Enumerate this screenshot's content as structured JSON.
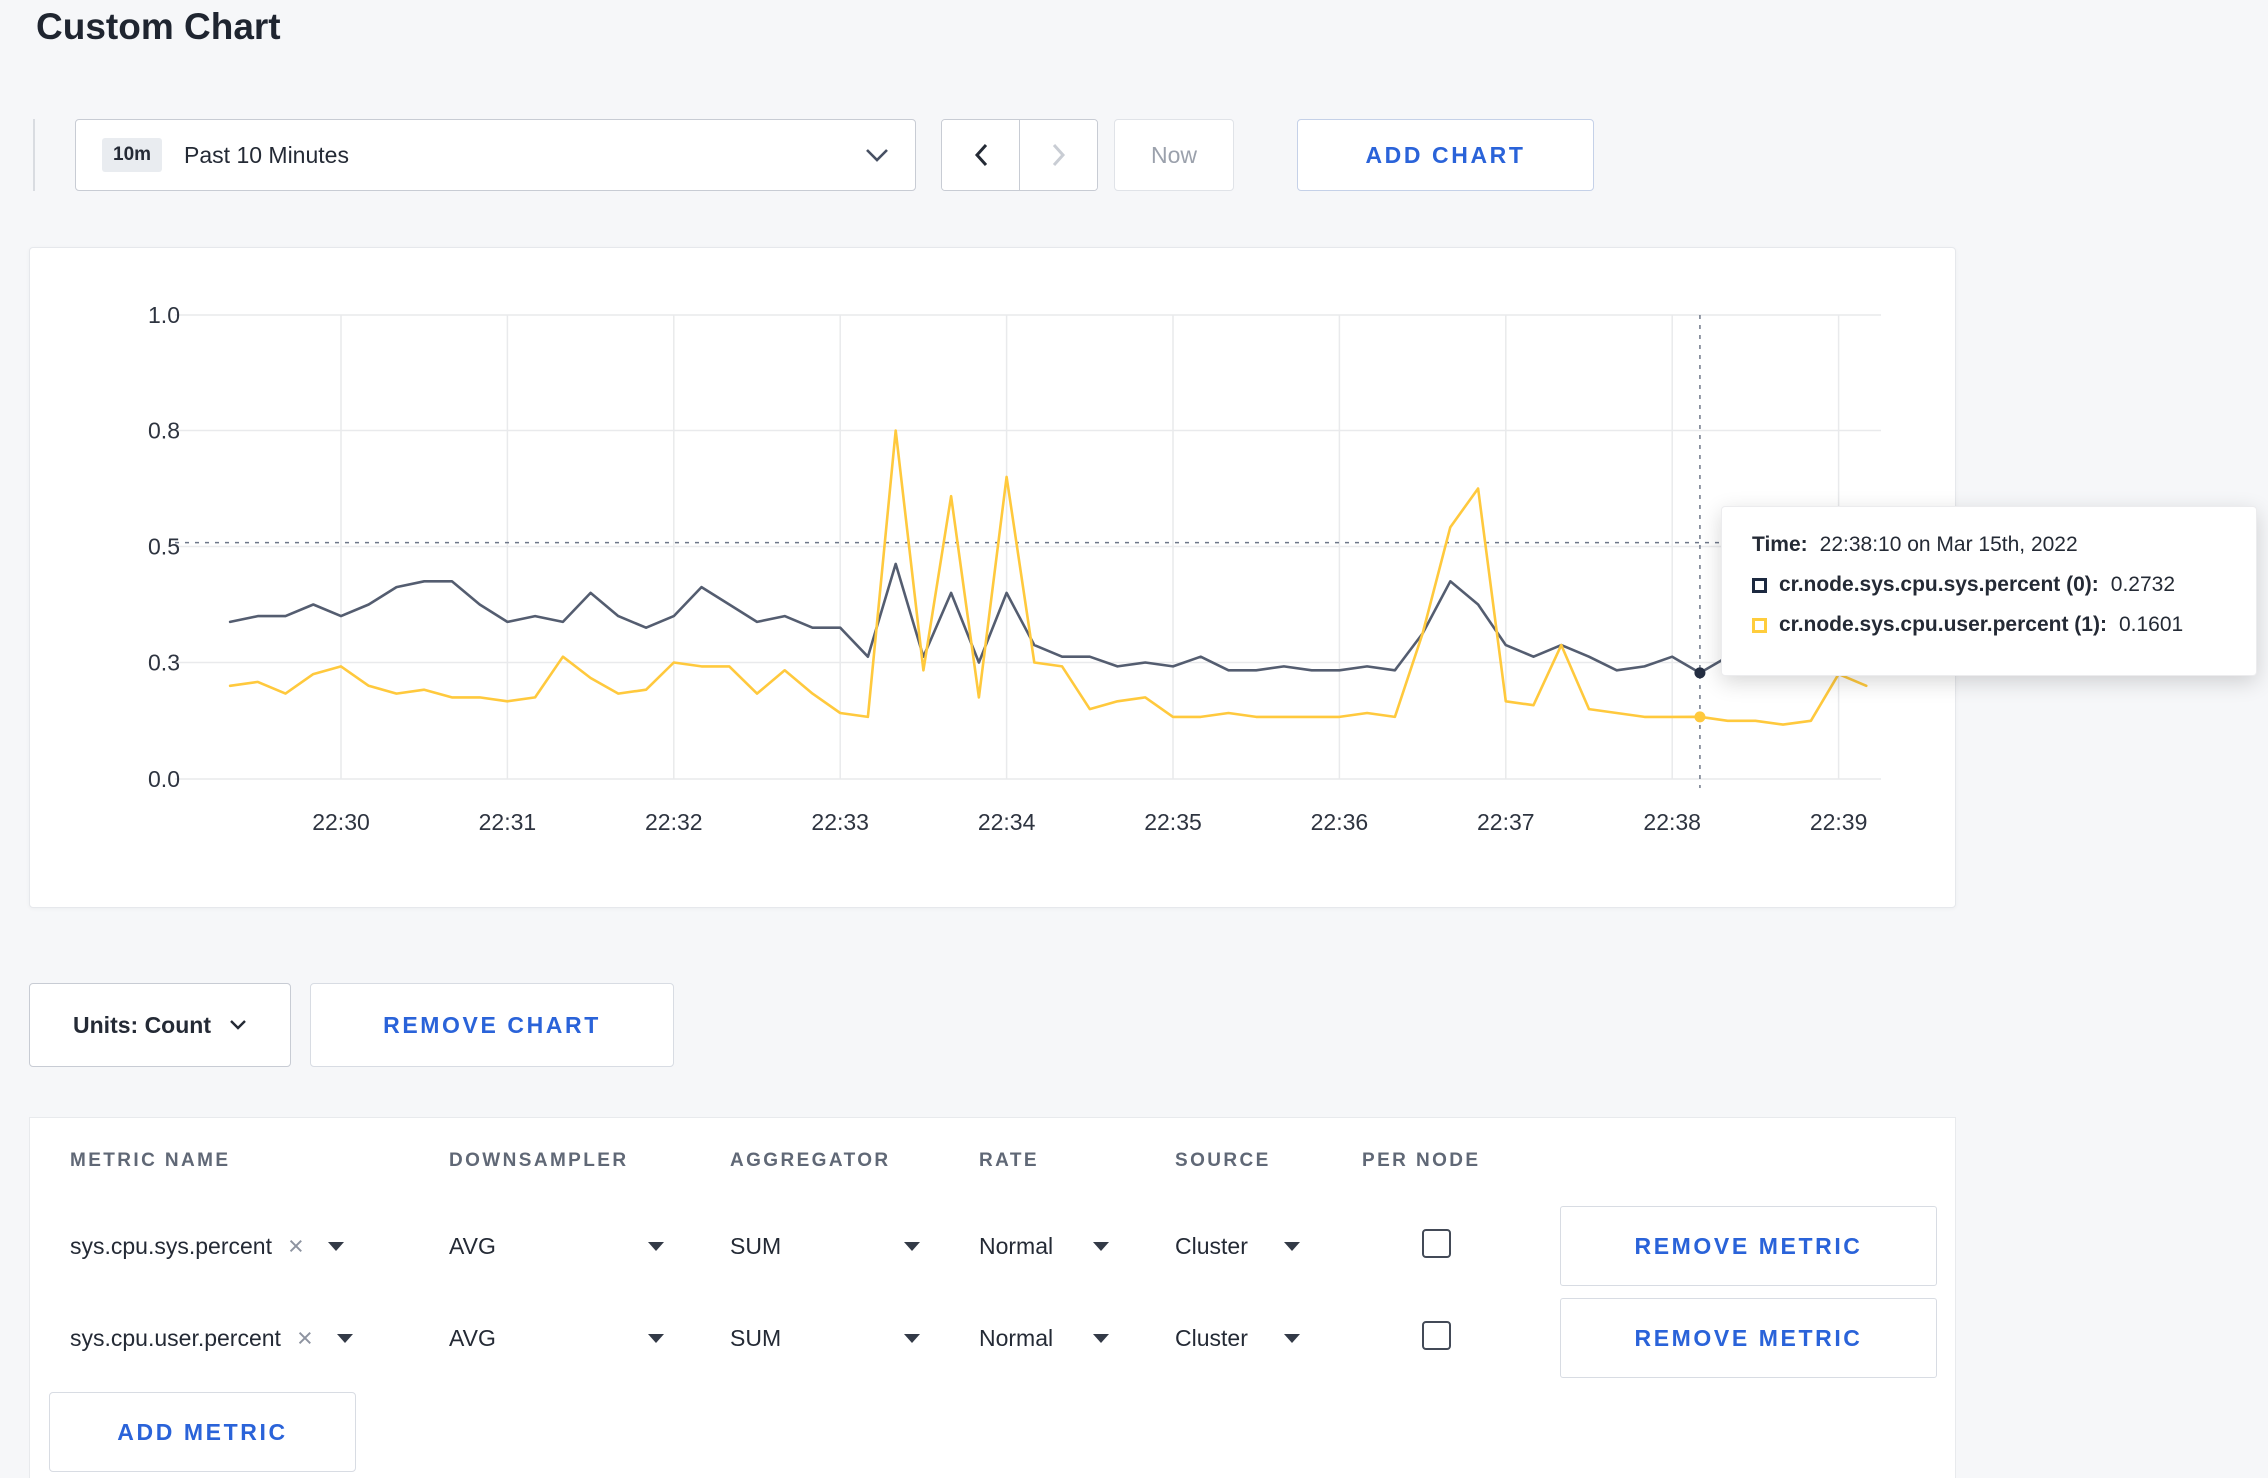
{
  "page": {
    "title": "Custom Chart"
  },
  "toolbar": {
    "range_badge": "10m",
    "range_label": "Past 10 Minutes",
    "now_label": "Now",
    "add_chart_label": "ADD CHART"
  },
  "chart_controls": {
    "units_label": "Units: Count",
    "remove_chart_label": "REMOVE CHART"
  },
  "tooltip": {
    "time_label": "Time:",
    "time_value": "22:38:10 on Mar 15th, 2022",
    "rows": [
      {
        "label": "cr.node.sys.cpu.sys.percent (0):",
        "value": "0.2732",
        "color": "#1c2940"
      },
      {
        "label": "cr.node.sys.cpu.user.percent (1):",
        "value": "0.1601",
        "color": "#ffcd3c"
      }
    ]
  },
  "chart_data": {
    "type": "line",
    "title": "",
    "xlabel": "",
    "ylabel": "",
    "grid": true,
    "legend_position": "none",
    "y_ticks": [
      0.0,
      0.3,
      0.5,
      0.8,
      1.0
    ],
    "y_tick_labels": [
      "0.0",
      "0.3",
      "0.5",
      "0.8",
      "1.0"
    ],
    "x_ticks": [
      "22:30",
      "22:31",
      "22:32",
      "22:33",
      "22:34",
      "22:35",
      "22:36",
      "22:37",
      "22:38",
      "22:39"
    ],
    "x_seconds_from_22_30": [
      -40,
      -30,
      -20,
      -10,
      0,
      10,
      20,
      30,
      40,
      50,
      60,
      70,
      80,
      90,
      100,
      110,
      120,
      130,
      140,
      150,
      160,
      170,
      180,
      190,
      200,
      210,
      220,
      230,
      240,
      250,
      260,
      270,
      280,
      290,
      300,
      310,
      320,
      330,
      340,
      350,
      360,
      370,
      380,
      390,
      400,
      410,
      420,
      430,
      440,
      450,
      460,
      470,
      480,
      490,
      500,
      510,
      520,
      530,
      540,
      550
    ],
    "series": [
      {
        "name": "cr.node.sys.cpu.sys.percent",
        "color": "#545d70",
        "dot_color": "#242e42",
        "values": [
          0.37,
          0.38,
          0.38,
          0.4,
          0.38,
          0.4,
          0.43,
          0.44,
          0.44,
          0.4,
          0.37,
          0.38,
          0.37,
          0.42,
          0.38,
          0.36,
          0.38,
          0.43,
          0.4,
          0.37,
          0.38,
          0.36,
          0.36,
          0.31,
          0.47,
          0.31,
          0.42,
          0.3,
          0.42,
          0.33,
          0.31,
          0.31,
          0.29,
          0.3,
          0.29,
          0.31,
          0.28,
          0.28,
          0.29,
          0.28,
          0.28,
          0.29,
          0.28,
          0.35,
          0.44,
          0.4,
          0.33,
          0.31,
          0.33,
          0.31,
          0.28,
          0.29,
          0.31,
          0.2732,
          0.31,
          0.3,
          null,
          null,
          null,
          null
        ]
      },
      {
        "name": "cr.node.sys.cpu.user.percent",
        "color": "#ffc93d",
        "dot_color": "#ffc93d",
        "values": [
          0.24,
          0.25,
          0.22,
          0.27,
          0.29,
          0.24,
          0.22,
          0.23,
          0.21,
          0.21,
          0.2,
          0.21,
          0.31,
          0.26,
          0.22,
          0.23,
          0.3,
          0.29,
          0.29,
          0.22,
          0.28,
          0.22,
          0.17,
          0.16,
          0.8,
          0.28,
          0.63,
          0.21,
          0.68,
          0.3,
          0.29,
          0.18,
          0.2,
          0.21,
          0.16,
          0.16,
          0.17,
          0.16,
          0.16,
          0.16,
          0.16,
          0.17,
          0.16,
          0.35,
          0.55,
          0.65,
          0.2,
          0.19,
          0.33,
          0.18,
          0.17,
          0.16,
          0.16,
          0.1601,
          0.15,
          0.15,
          0.14,
          0.15,
          0.27,
          0.24
        ]
      }
    ],
    "crosshair": {
      "time_sec_from_22_30": 490,
      "time_label": "22:38:10 on Mar 15th, 2022",
      "mouse_value": 0.51,
      "points": [
        {
          "series": 0,
          "value": 0.2732
        },
        {
          "series": 1,
          "value": 0.1601
        }
      ]
    }
  },
  "metrics_table": {
    "headers": [
      "METRIC NAME",
      "DOWNSAMPLER",
      "AGGREGATOR",
      "RATE",
      "SOURCE",
      "PER NODE"
    ],
    "rows": [
      {
        "metric": "sys.cpu.sys.percent",
        "downsampler": "AVG",
        "aggregator": "SUM",
        "rate": "Normal",
        "source": "Cluster",
        "per_node": false,
        "remove_label": "REMOVE METRIC"
      },
      {
        "metric": "sys.cpu.user.percent",
        "downsampler": "AVG",
        "aggregator": "SUM",
        "rate": "Normal",
        "source": "Cluster",
        "per_node": false,
        "remove_label": "REMOVE METRIC"
      }
    ],
    "add_metric_label": "ADD METRIC"
  },
  "icons": {
    "clear": "×"
  },
  "colors": {
    "accent_blue": "#2a63d9",
    "series_sys": "#545d70",
    "series_user": "#ffc93d",
    "swatch_sys": "#1c2940",
    "swatch_user": "#ffcd3c",
    "crosshair": "#6e7789",
    "grid": "#e9eaec"
  }
}
